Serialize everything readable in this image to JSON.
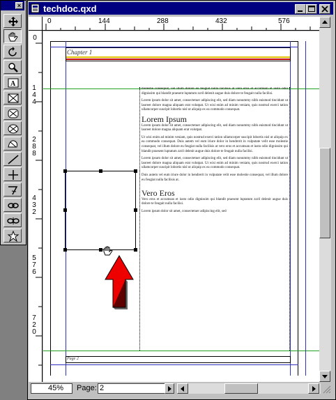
{
  "tool_palette": {
    "close_label": "×",
    "tools": [
      "move-tool-icon",
      "content-tool-icon",
      "rotate-tool-icon",
      "zoom-tool-icon",
      "text-box-tool-icon",
      "rectangle-picture-box-icon",
      "rounded-picture-box-icon",
      "oval-picture-box-icon",
      "bezier-picture-box-icon",
      "line-tool-icon",
      "orthogonal-line-icon",
      "bezier-line-icon",
      "link-tool-icon",
      "unlink-tool-icon",
      "starburst-tool-icon"
    ]
  },
  "window": {
    "title": "techdoc.qxd",
    "min_label": "_",
    "max_label": "□",
    "close_label": "×"
  },
  "ruler": {
    "h_ticks": [
      "0",
      "144",
      "288",
      "432",
      "576"
    ],
    "v_ticks": [
      "0",
      "1 4 4",
      "2 8 8",
      "4 3 2",
      "5 7 6",
      "7 2 0"
    ]
  },
  "page": {
    "chapter_header": "Chapter 1",
    "footer": "Page 2",
    "headings": [
      "Lorem Ipsum",
      "Vero Eros"
    ],
    "paragraphs": [
      "molestie consequat, vel illum dolore eu feugiat nulla facilisis at vero eros et accumsan et iusto odio dignissim qui blandit praesent luptatum zzril delenit augue duis dolore te feugait nulla facilisi.",
      "Lorem ipsum dolor sit amet, consectetuer adipiscing elit, sed diam nonummy nibh euismod tincidunt ut laoreet dolore magna aliquam erat volutpat. Ut wisi enim ad minim veniam, quis nostrud exerci tation ullamcorper suscipit lobortis nisl ut aliquip ex ea commodo consequat.",
      "Lorem ipsum dolor sit amet, consectetuer adipiscing elit, sed diam nonummy nibh euismod tincidunt ut laoreet dolore magna aliquam erat volutpat.",
      "Ut wisi enim ad minim veniam, quis nostrud exerci tation ullamcorper suscipit lobortis nisl ut aliquip ex ea commodo consequat. Duis autem vel eum iriure dolor in hendrerit in vulputate velit esse molestie consequat, vel illum dolore eu feugiat nulla facilisis at vero eros et accumsan et iusto odio dignissim qui blandit praesent luptatum zzril delenit augue duis dolore te feugait nulla facilisi.",
      "Lorem ipsum dolor sit amet, consectetuer adipiscing elit, sed diam nonummy nibh euismod tincidunt ut laoreet dolore magna aliquam erat volutpat. Ut wisi enim ad minim veniam, quis nostrud exerci tation ullamcorper suscipit lobortis nisl ut aliquip ex ea commodo consequat.",
      "Duis autem vel eum iriure dolor in hendrerit in vulputate velit esse molestie consequat, vel illum dolore eu feugiat nulla facilisis at.",
      "Vero eros et accumsan et iusto odio dignissim qui blandit praesent luptatum zzril delenit augue duis dolore te feugait nulla facilisi.",
      "Lorem ipsum dolor sit amet, consectetuer adipiscing elit, sed"
    ]
  },
  "status": {
    "zoom": "45%",
    "page_label": "Page:",
    "page_value": "2"
  },
  "colors": {
    "title_bar": "#000080",
    "guide_blue": "#3030c0",
    "guide_green": "#20a020",
    "header_rule_red": "#c00000",
    "header_rule_yellow": "#e0c000",
    "arrow_red": "#ee0000"
  }
}
